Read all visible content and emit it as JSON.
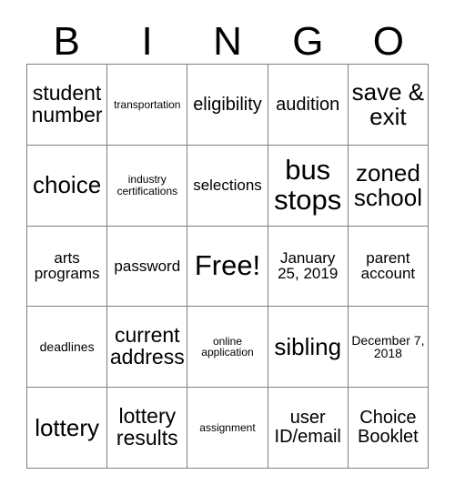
{
  "card": {
    "title": "BINGO",
    "header_letters": [
      "B",
      "I",
      "N",
      "G",
      "O"
    ],
    "border_color": "#808080",
    "text_color": "#000000",
    "background_color": "#ffffff",
    "rows": 5,
    "columns": 5,
    "free_space_label": "Free!"
  },
  "cells": [
    {
      "text": "student number",
      "size": "fs-lg"
    },
    {
      "text": "transportation",
      "size": "fs-xxs"
    },
    {
      "text": "eligibility",
      "size": "fs-md"
    },
    {
      "text": "audition",
      "size": "fs-md"
    },
    {
      "text": "save & exit",
      "size": "fs-xl"
    },
    {
      "text": "choice",
      "size": "fs-xl"
    },
    {
      "text": "industry certifications",
      "size": "fs-xxs"
    },
    {
      "text": "selections",
      "size": "fs-sm"
    },
    {
      "text": "bus stops",
      "size": "fs-xxl"
    },
    {
      "text": "zoned school",
      "size": "fs-xl"
    },
    {
      "text": "arts programs",
      "size": "fs-sm"
    },
    {
      "text": "password",
      "size": "fs-sm"
    },
    {
      "text": "Free!",
      "size": "fs-xxl"
    },
    {
      "text": "January 25, 2019",
      "size": "fs-sm"
    },
    {
      "text": "parent account",
      "size": "fs-sm"
    },
    {
      "text": "deadlines",
      "size": "fs-xs"
    },
    {
      "text": "current address",
      "size": "fs-lg"
    },
    {
      "text": "online application",
      "size": "fs-xxs"
    },
    {
      "text": "sibling",
      "size": "fs-xl"
    },
    {
      "text": "December 7, 2018",
      "size": "fs-xs"
    },
    {
      "text": "lottery",
      "size": "fs-xl"
    },
    {
      "text": "lottery results",
      "size": "fs-lg"
    },
    {
      "text": "assignment",
      "size": "fs-xxs"
    },
    {
      "text": "user ID/email",
      "size": "fs-md"
    },
    {
      "text": "Choice Booklet",
      "size": "fs-md"
    }
  ]
}
